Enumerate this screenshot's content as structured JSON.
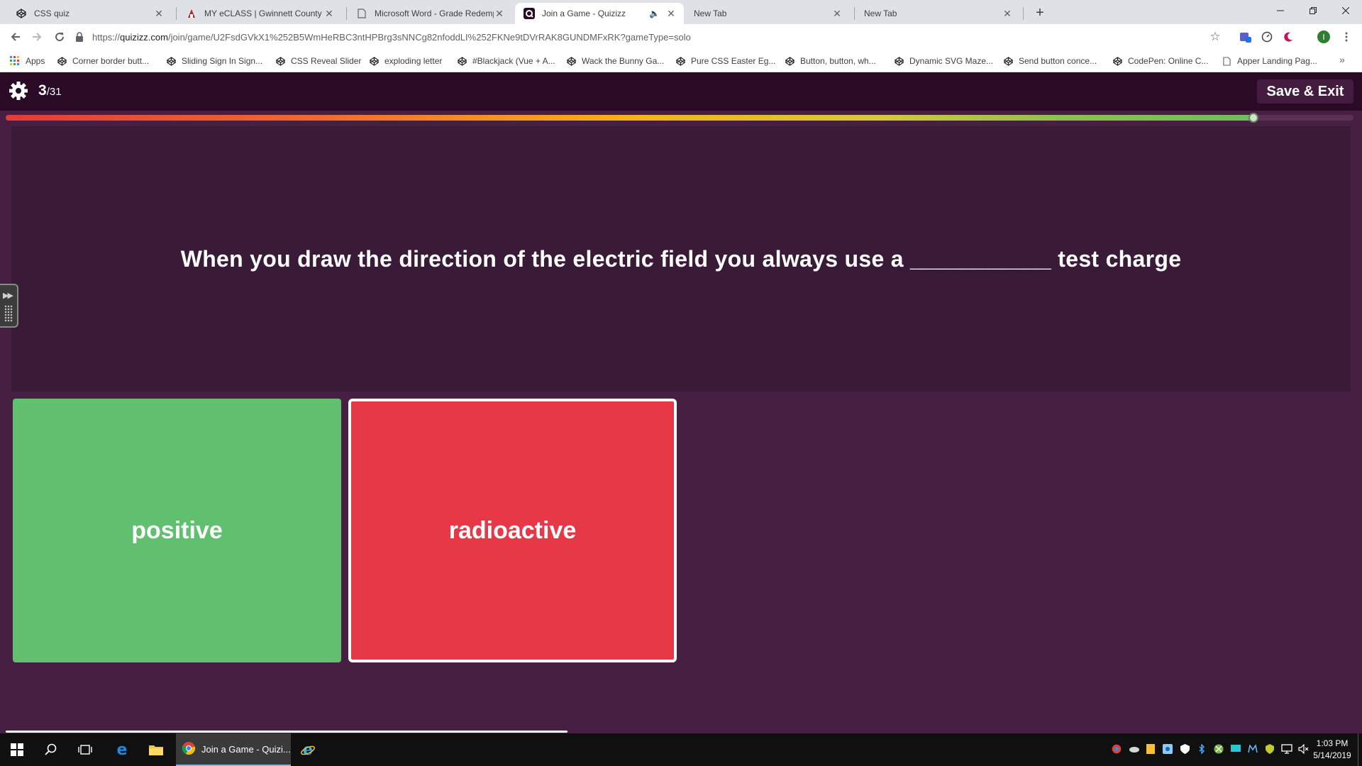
{
  "browser": {
    "tabs": [
      {
        "title": "CSS quiz",
        "icon": "codepen-icon",
        "active": false
      },
      {
        "title": "MY eCLASS | Gwinnett County Pu",
        "icon": "eclass-icon",
        "active": false
      },
      {
        "title": "Microsoft Word - Grade Redemp",
        "icon": "document-icon",
        "active": false
      },
      {
        "title": "Join a Game - Quizizz",
        "icon": "quizizz-icon",
        "active": true,
        "audio": true
      },
      {
        "title": "New Tab",
        "icon": "",
        "active": false
      },
      {
        "title": "New Tab",
        "icon": "",
        "active": false
      }
    ],
    "url": {
      "scheme": "https://",
      "host": "quizizz.com",
      "path": "/join/game/U2FsdGVkX1%252B5WmHeRBC3ntHPBrg3sNNCg82nfoddLI%252FKNe9tDVrRAK8GUNDMFxRK?gameType=solo"
    },
    "bookmarks": [
      {
        "label": "Apps",
        "icon": "apps-grid-icon"
      },
      {
        "label": "Corner border butt...",
        "icon": "codepen-icon"
      },
      {
        "label": "Sliding Sign In Sign...",
        "icon": "codepen-icon"
      },
      {
        "label": "CSS Reveal Slider",
        "icon": "codepen-icon"
      },
      {
        "label": "exploding letter",
        "icon": "codepen-icon"
      },
      {
        "label": "#Blackjack (Vue + A...",
        "icon": "codepen-icon"
      },
      {
        "label": "Wack the Bunny Ga...",
        "icon": "codepen-icon"
      },
      {
        "label": "Pure CSS Easter Eg...",
        "icon": "codepen-icon"
      },
      {
        "label": "Button, button, wh...",
        "icon": "codepen-icon"
      },
      {
        "label": "Dynamic SVG Maze...",
        "icon": "codepen-icon"
      },
      {
        "label": "Send button conce...",
        "icon": "codepen-icon"
      },
      {
        "label": "CodePen: Online C...",
        "icon": "codepen-icon"
      },
      {
        "label": "Apper Landing Pag...",
        "icon": "document-icon"
      }
    ],
    "profile_initial": "I"
  },
  "quiz": {
    "current_question": "3",
    "total_questions": "/31",
    "save_exit_label": "Save & Exit",
    "progress": 0.926,
    "question": "When you draw the direction of the electric field you always use a ___________ test charge",
    "options": [
      {
        "label": "positive",
        "color": "#60c070"
      },
      {
        "label": "radioactive",
        "color": "#e63847"
      }
    ]
  },
  "taskbar": {
    "active_app_label": "Join a Game - Quizi...",
    "time": "1:03 PM",
    "date": "5/14/2019"
  },
  "colors": {
    "page_bg": "#461f42",
    "topbar_bg": "#2b0a26",
    "question_bg": "#3a1b37"
  }
}
